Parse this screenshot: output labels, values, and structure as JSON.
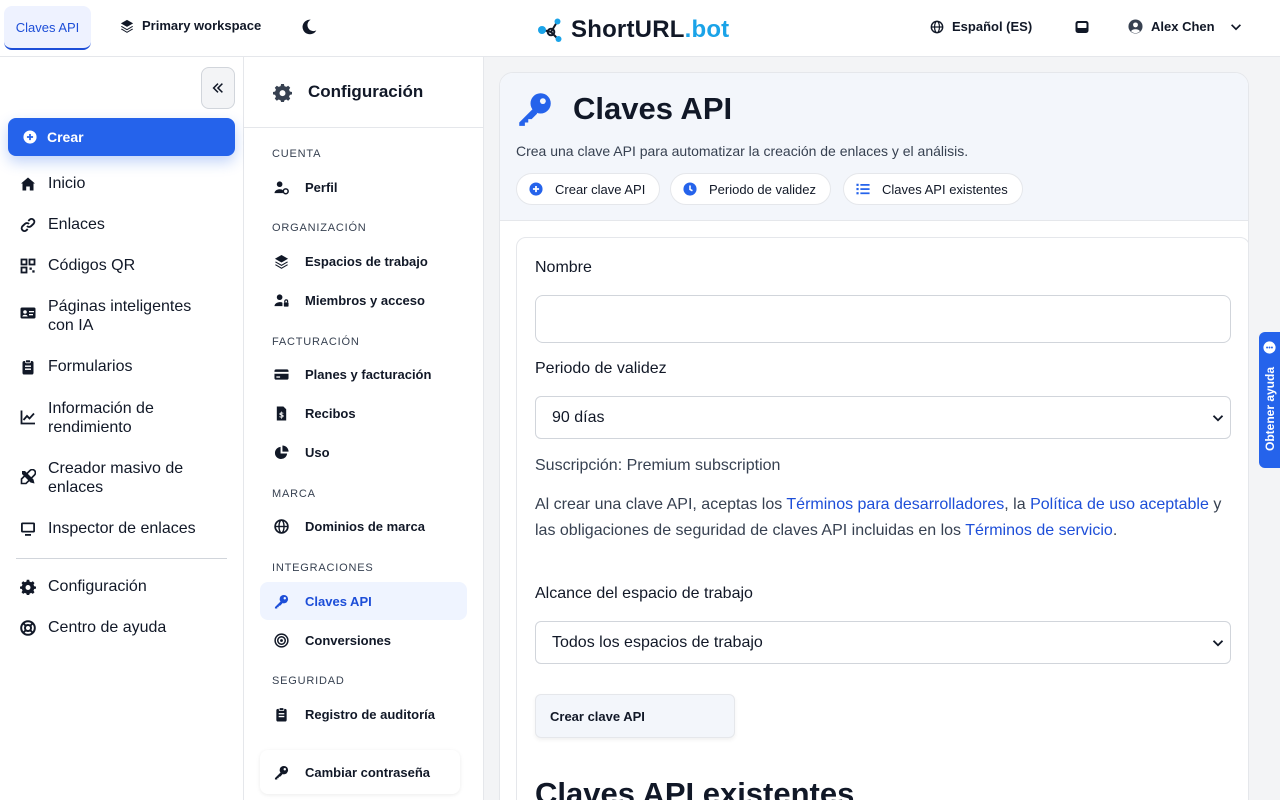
{
  "topbar": {
    "active_tab": "Claves API",
    "workspace": "Primary workspace",
    "logo_main": "ShortURL",
    "logo_suffix": ".bot",
    "language": "Español (ES)",
    "user_name": "Alex Chen"
  },
  "sidebar": {
    "create_label": "Crear",
    "items": [
      {
        "label": "Inicio",
        "icon": "home-icon"
      },
      {
        "label": "Enlaces",
        "icon": "link-icon"
      },
      {
        "label": "Códigos QR",
        "icon": "qr-code-icon"
      },
      {
        "label": "Páginas inteligentes con IA",
        "icon": "id-card-icon"
      },
      {
        "label": "Formularios",
        "icon": "clipboard-icon"
      },
      {
        "label": "Información de rendimiento",
        "icon": "chart-line-icon"
      },
      {
        "label": "Creador masivo de enlaces",
        "icon": "tools-icon"
      },
      {
        "label": "Inspector de enlaces",
        "icon": "monitor-icon"
      },
      {
        "label": "Configuración",
        "icon": "gear-icon"
      },
      {
        "label": "Centro de ayuda",
        "icon": "lifebuoy-icon"
      }
    ]
  },
  "settings": {
    "title": "Configuración",
    "sections": {
      "cuenta": "CUENTA",
      "organizacion": "ORGANIZACIÓN",
      "facturacion": "FACTURACIÓN",
      "marca": "MARCA",
      "integraciones": "INTEGRACIONES",
      "seguridad": "SEGURIDAD"
    },
    "items": {
      "perfil": "Perfil",
      "espacios": "Espacios de trabajo",
      "miembros": "Miembros y acceso",
      "planes": "Planes y facturación",
      "recibos": "Recibos",
      "uso": "Uso",
      "dominios": "Dominios de marca",
      "claves": "Claves API",
      "conversiones": "Conversiones",
      "auditoria": "Registro de auditoría",
      "password": "Cambiar contraseña"
    }
  },
  "main": {
    "title": "Claves API",
    "subtitle": "Crea una clave API para automatizar la creación de enlaces y el análisis.",
    "chips": [
      "Crear clave API",
      "Periodo de validez",
      "Claves API existentes"
    ],
    "form": {
      "name_label": "Nombre",
      "name_value": "",
      "validity_label": "Periodo de validez",
      "validity_value": "90 días",
      "subscription": "Suscripción: Premium subscription",
      "terms_1": "Al crear una clave API, aceptas los ",
      "terms_link_1": "Términos para desarrolladores",
      "terms_2": ", la ",
      "terms_link_2": "Política de uso aceptable",
      "terms_3": " y las obligaciones de seguridad de claves API incluidas en los ",
      "terms_link_3": "Términos de servicio",
      "terms_4": ".",
      "scope_label": "Alcance del espacio de trabajo",
      "scope_value": "Todos los espacios de trabajo",
      "submit_label": "Crear clave API"
    },
    "existing_title": "Claves API existentes"
  },
  "help_tab": "Obtener ayuda",
  "colors": {
    "accent": "#2563eb",
    "accent_dark": "#1d4ed8",
    "logo_cyan": "#1aa3e8"
  }
}
